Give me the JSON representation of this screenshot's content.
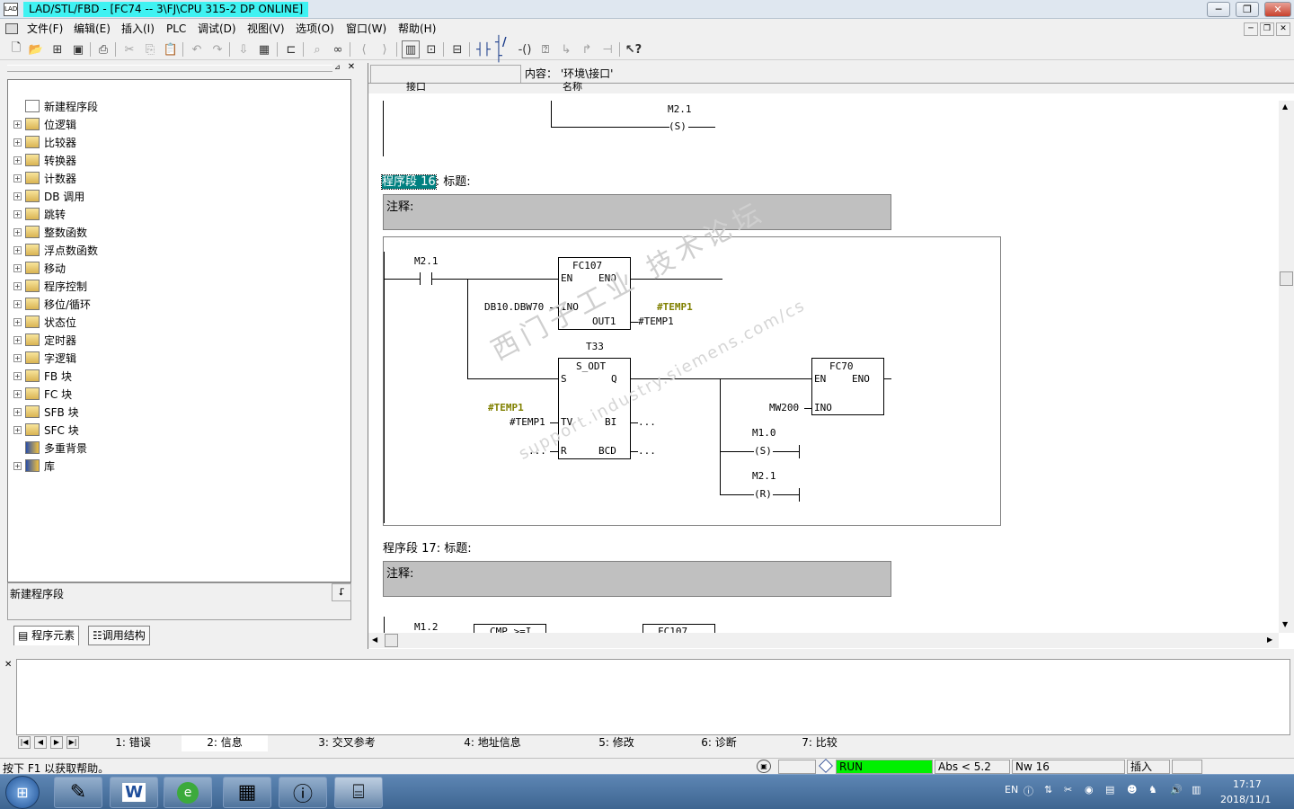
{
  "window": {
    "title": "LAD/STL/FBD  - [FC74 -- 3\\FJ\\CPU 315-2 DP  ONLINE]"
  },
  "menu": [
    "文件(F)",
    "编辑(E)",
    "插入(I)",
    "PLC",
    "调试(D)",
    "视图(V)",
    "选项(O)",
    "窗口(W)",
    "帮助(H)"
  ],
  "tree": {
    "items": [
      {
        "label": "新建程序段",
        "icon": "network-icon"
      },
      {
        "label": "位逻辑",
        "icon": "bit-logic-icon"
      },
      {
        "label": "比较器",
        "icon": "comparator-icon"
      },
      {
        "label": "转换器",
        "icon": "converter-icon"
      },
      {
        "label": "计数器",
        "icon": "counter-icon"
      },
      {
        "label": "DB 调用",
        "icon": "db-call-icon"
      },
      {
        "label": "跳转",
        "icon": "jump-icon"
      },
      {
        "label": "整数函数",
        "icon": "integer-function-icon"
      },
      {
        "label": "浮点数函数",
        "icon": "float-function-icon"
      },
      {
        "label": "移动",
        "icon": "move-icon"
      },
      {
        "label": "程序控制",
        "icon": "program-control-icon"
      },
      {
        "label": "移位/循环",
        "icon": "shift-rotate-icon"
      },
      {
        "label": "状态位",
        "icon": "status-bit-icon"
      },
      {
        "label": "定时器",
        "icon": "timer-icon"
      },
      {
        "label": "字逻辑",
        "icon": "word-logic-icon"
      },
      {
        "label": "FB 块",
        "icon": "fb-block-icon"
      },
      {
        "label": "FC 块",
        "icon": "fc-block-icon"
      },
      {
        "label": "SFB 块",
        "icon": "sfb-block-icon"
      },
      {
        "label": "SFC 块",
        "icon": "sfc-block-icon"
      },
      {
        "label": "多重背景",
        "icon": "multi-instance-icon"
      },
      {
        "label": "库",
        "icon": "library-icon"
      }
    ],
    "description": "新建程序段"
  },
  "left_tabs": [
    "程序元素",
    "调用结构"
  ],
  "interface": {
    "content_label": "内容：  '环境\\接口'",
    "col_interface": "接口",
    "col_name": "名称"
  },
  "ladder": {
    "top_coil_addr": "M2.1",
    "coil_s": "S",
    "net16": {
      "title_prefix": "程序段 16",
      "title_suffix": ": 标题:",
      "comment_label": "注释:"
    },
    "contact_addr": "M2.1",
    "fc107": {
      "name": "FC107",
      "en": "EN",
      "eno": "ENO",
      "ino": "INO",
      "out1": "OUT1",
      "ino_val": "DB10.DBW70",
      "out1_val": "#TEMP1",
      "out1_sym": "#TEMP1"
    },
    "timer": {
      "name": "T33",
      "type": "S_ODT",
      "s": "S",
      "q": "Q",
      "tv": "TV",
      "bi": "BI",
      "r": "R",
      "bcd": "BCD",
      "tv_val": "#TEMP1",
      "tv_sym": "#TEMP1",
      "bi_val": "...",
      "r_val": "...",
      "bcd_val": "..."
    },
    "fc70": {
      "name": "FC70",
      "en": "EN",
      "eno": "ENO",
      "ino": "INO",
      "ino_val": "MW200"
    },
    "coil1_addr": "M1.0",
    "coil1_type": "S",
    "coil2_addr": "M2.1",
    "coil2_type": "R",
    "net17": {
      "title_prefix": "程序段 17",
      "title_suffix": ": 标题:",
      "comment_label": "注释:"
    },
    "net17_contact": "M1.2",
    "net17_cmp": "CMP >=I",
    "net17_fc": "FC107"
  },
  "watermark": "西门子工业  技术论坛",
  "watermark2": "support.industry.siemens.com/cs",
  "bottom_tabs": [
    "1: 错误",
    "2: 信息",
    "3: 交叉参考",
    "4: 地址信息",
    "5: 修改",
    "6: 诊断",
    "7: 比较"
  ],
  "status": {
    "help": "按下 F1 以获取帮助。",
    "run": "RUN",
    "abs": "Abs < 5.2",
    "nw": "Nw 16",
    "mode": "插入"
  },
  "taskbar": {
    "lang": "EN",
    "time": "17:17",
    "date": "2018/11/1"
  },
  "colors": {
    "run_green": "#00f000",
    "title_highlight": "#3ff2f2",
    "segment_highlight": "#008080",
    "symbol_olive": "#808000"
  }
}
